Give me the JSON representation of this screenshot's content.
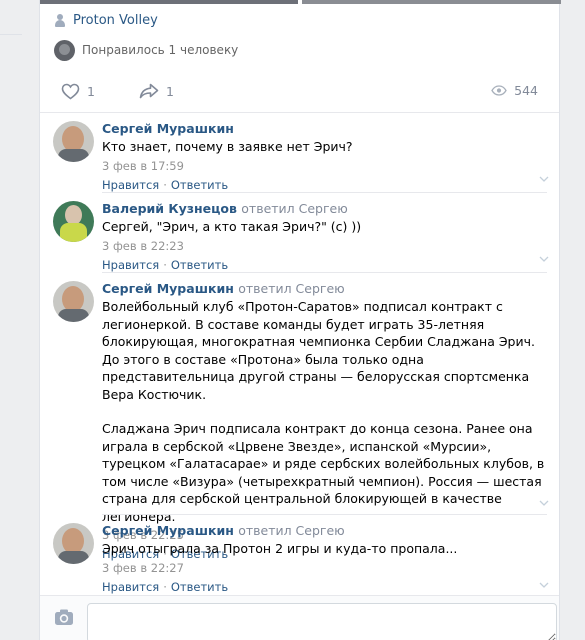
{
  "post": {
    "group_name": "Proton Volley",
    "likers_text": "Понравилось 1 человеку",
    "likes_count": "1",
    "shares_count": "1",
    "views_count": "544"
  },
  "comments": [
    {
      "author": "Сергей Мурашкин",
      "replied_to": "",
      "paragraphs": [
        "Кто знает, почему в заявке нет Эрич?"
      ],
      "time": "3 фев в 17:59",
      "like_label": "Нравится",
      "reply_label": "Ответить"
    },
    {
      "author": "Валерий Кузнецов",
      "replied_to": "ответил Сергею",
      "paragraphs": [
        "Сергей, \"Эрич, а кто такая Эрич?\" (с) ))"
      ],
      "time": "3 фев в 22:23",
      "like_label": "Нравится",
      "reply_label": "Ответить"
    },
    {
      "author": "Сергей Мурашкин",
      "replied_to": "ответил Сергею",
      "paragraphs": [
        "Волейбольный клуб «Протон-Саратов» подписал контракт с легионеркой. В составе команды будет играть 35-летняя блокирующая, многократная чемпионка Сербии Сладжана Эрич. До этого в составе «Протона» была только одна представительница другой страны — белорусская спортсменка Вера Костючик.",
        "Сладжана Эрич подписала контракт до конца сезона. Ранее она играла в сербской «Црвене Звезде», испанской «Мурсии», турецком «Галатасарае» и ряде сербских волейбольных клубов, в том числе «Визура» (четырехкратный чемпион). Россия — шестая страна для сербской центральной блокирующей в качестве легионера."
      ],
      "time": "3 фев в 22:25",
      "like_label": "Нравится",
      "reply_label": "Ответить"
    },
    {
      "author": "Сергей Мурашкин",
      "replied_to": "ответил Сергею",
      "paragraphs": [
        "Эрич отыграла за Протон 2 игры и куда-то пропала..."
      ],
      "time": "3 фев в 22:27",
      "like_label": "Нравится",
      "reply_label": "Ответить"
    }
  ],
  "composer": {
    "placeholder": ""
  },
  "colors": {
    "link": "#2a5885",
    "meta": "#939393",
    "background": "#edeef0"
  }
}
